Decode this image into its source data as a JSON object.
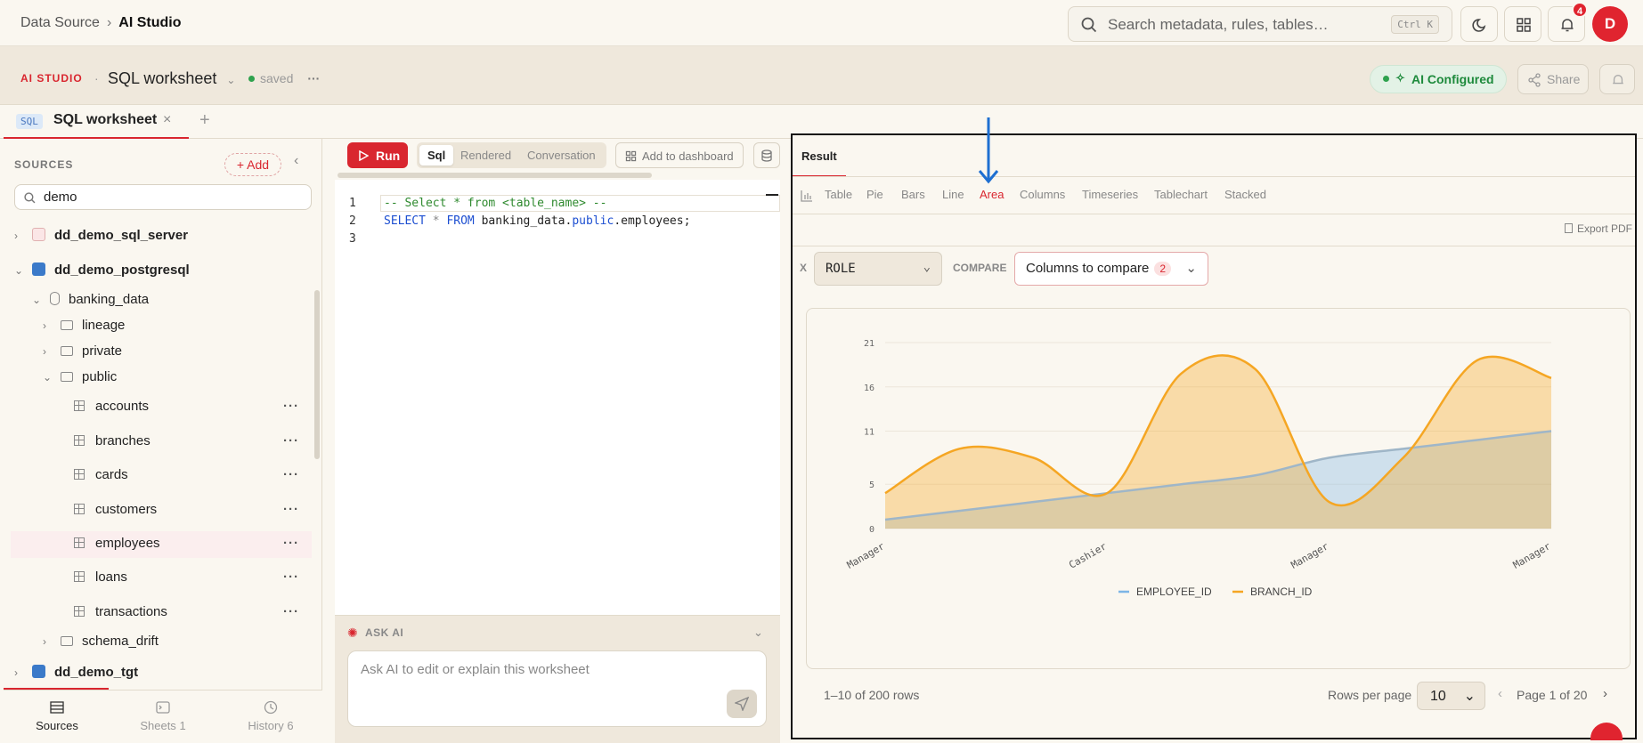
{
  "breadcrumb": {
    "parent": "Data Source",
    "current": "AI Studio"
  },
  "search": {
    "placeholder": "Search metadata, rules, tables…",
    "shortcut": "Ctrl K"
  },
  "header": {
    "notifications_count": "4",
    "avatar_initial": "D"
  },
  "studio": {
    "label": "AI STUDIO",
    "worksheet_title": "SQL worksheet",
    "status": "saved",
    "ai_status": "AI Configured",
    "share_label": "Share"
  },
  "tab": {
    "tag": "SQL",
    "title": "SQL worksheet"
  },
  "sidebar": {
    "heading": "SOURCES",
    "add_label": "+ Add",
    "filter_value": "demo",
    "tree": [
      {
        "label": "dd_demo_sql_server",
        "level": 0,
        "kind": "db-red",
        "expanded": false
      },
      {
        "label": "dd_demo_postgresql",
        "level": 0,
        "kind": "db",
        "expanded": true
      },
      {
        "label": "banking_data",
        "level": 1,
        "kind": "schema",
        "expanded": true
      },
      {
        "label": "lineage",
        "level": 2,
        "kind": "folder",
        "expanded": false
      },
      {
        "label": "private",
        "level": 2,
        "kind": "folder",
        "expanded": false
      },
      {
        "label": "public",
        "level": 2,
        "kind": "folder",
        "expanded": true
      },
      {
        "label": "accounts",
        "level": 3,
        "kind": "table"
      },
      {
        "label": "branches",
        "level": 3,
        "kind": "table"
      },
      {
        "label": "cards",
        "level": 3,
        "kind": "table"
      },
      {
        "label": "customers",
        "level": 3,
        "kind": "table"
      },
      {
        "label": "employees",
        "level": 3,
        "kind": "table",
        "selected": true
      },
      {
        "label": "loans",
        "level": 3,
        "kind": "table"
      },
      {
        "label": "transactions",
        "level": 3,
        "kind": "table"
      },
      {
        "label": "schema_drift",
        "level": 2,
        "kind": "folder",
        "expanded": false
      },
      {
        "label": "dd_demo_tgt",
        "level": 0,
        "kind": "db",
        "expanded": false
      }
    ],
    "footer": [
      {
        "label": "Sources",
        "count": ""
      },
      {
        "label": "Sheets",
        "count": "1"
      },
      {
        "label": "History",
        "count": "6"
      }
    ]
  },
  "editor": {
    "run_label": "Run",
    "modes": [
      "Sql",
      "Rendered",
      "Conversation"
    ],
    "add_dashboard_label": "Add to dashboard",
    "line_numbers": [
      "1",
      "2",
      "3"
    ],
    "comment_line": "-- Select * from <table_name> --",
    "query": {
      "select": "SELECT",
      "star": "*",
      "from": "FROM",
      "table_a": "banking_data.",
      "table_b": "public",
      "table_c": ".employees;"
    }
  },
  "ask_ai": {
    "label": "ASK AI",
    "placeholder": "Ask AI to edit or explain this worksheet"
  },
  "result": {
    "tab_label": "Result",
    "chart_types": [
      "Table",
      "Pie",
      "Bars",
      "Line",
      "Area",
      "Columns",
      "Timeseries",
      "Tablechart",
      "Stacked"
    ],
    "active_chart_type": "Area",
    "export_label": "Export PDF",
    "x_label": "X",
    "x_value": "ROLE",
    "compare_label": "COMPARE",
    "compare_value": "Columns to compare",
    "compare_count": "2",
    "rows_info": "1–10 of 200 rows",
    "rows_per_page_label": "Rows per page",
    "rows_per_page": "10",
    "page_info": "Page 1 of 20"
  },
  "colors": {
    "accent": "#d9262f",
    "employee": "#7db5e6",
    "branch": "#f5a623"
  },
  "chart_data": {
    "type": "area",
    "x_tick_labels": [
      "Manager",
      "Cashier",
      "Manager",
      "Manager"
    ],
    "ylim": [
      0,
      21
    ],
    "y_ticks": [
      0,
      5,
      11,
      16,
      21
    ],
    "grid": true,
    "legend_position": "bottom",
    "series": [
      {
        "name": "EMPLOYEE_ID",
        "values": [
          1,
          2,
          3,
          4,
          5,
          6,
          8,
          9,
          10,
          11
        ]
      },
      {
        "name": "BRANCH_ID",
        "values": [
          4,
          9,
          8,
          4,
          17.5,
          18,
          3,
          8,
          19,
          17
        ]
      }
    ]
  }
}
